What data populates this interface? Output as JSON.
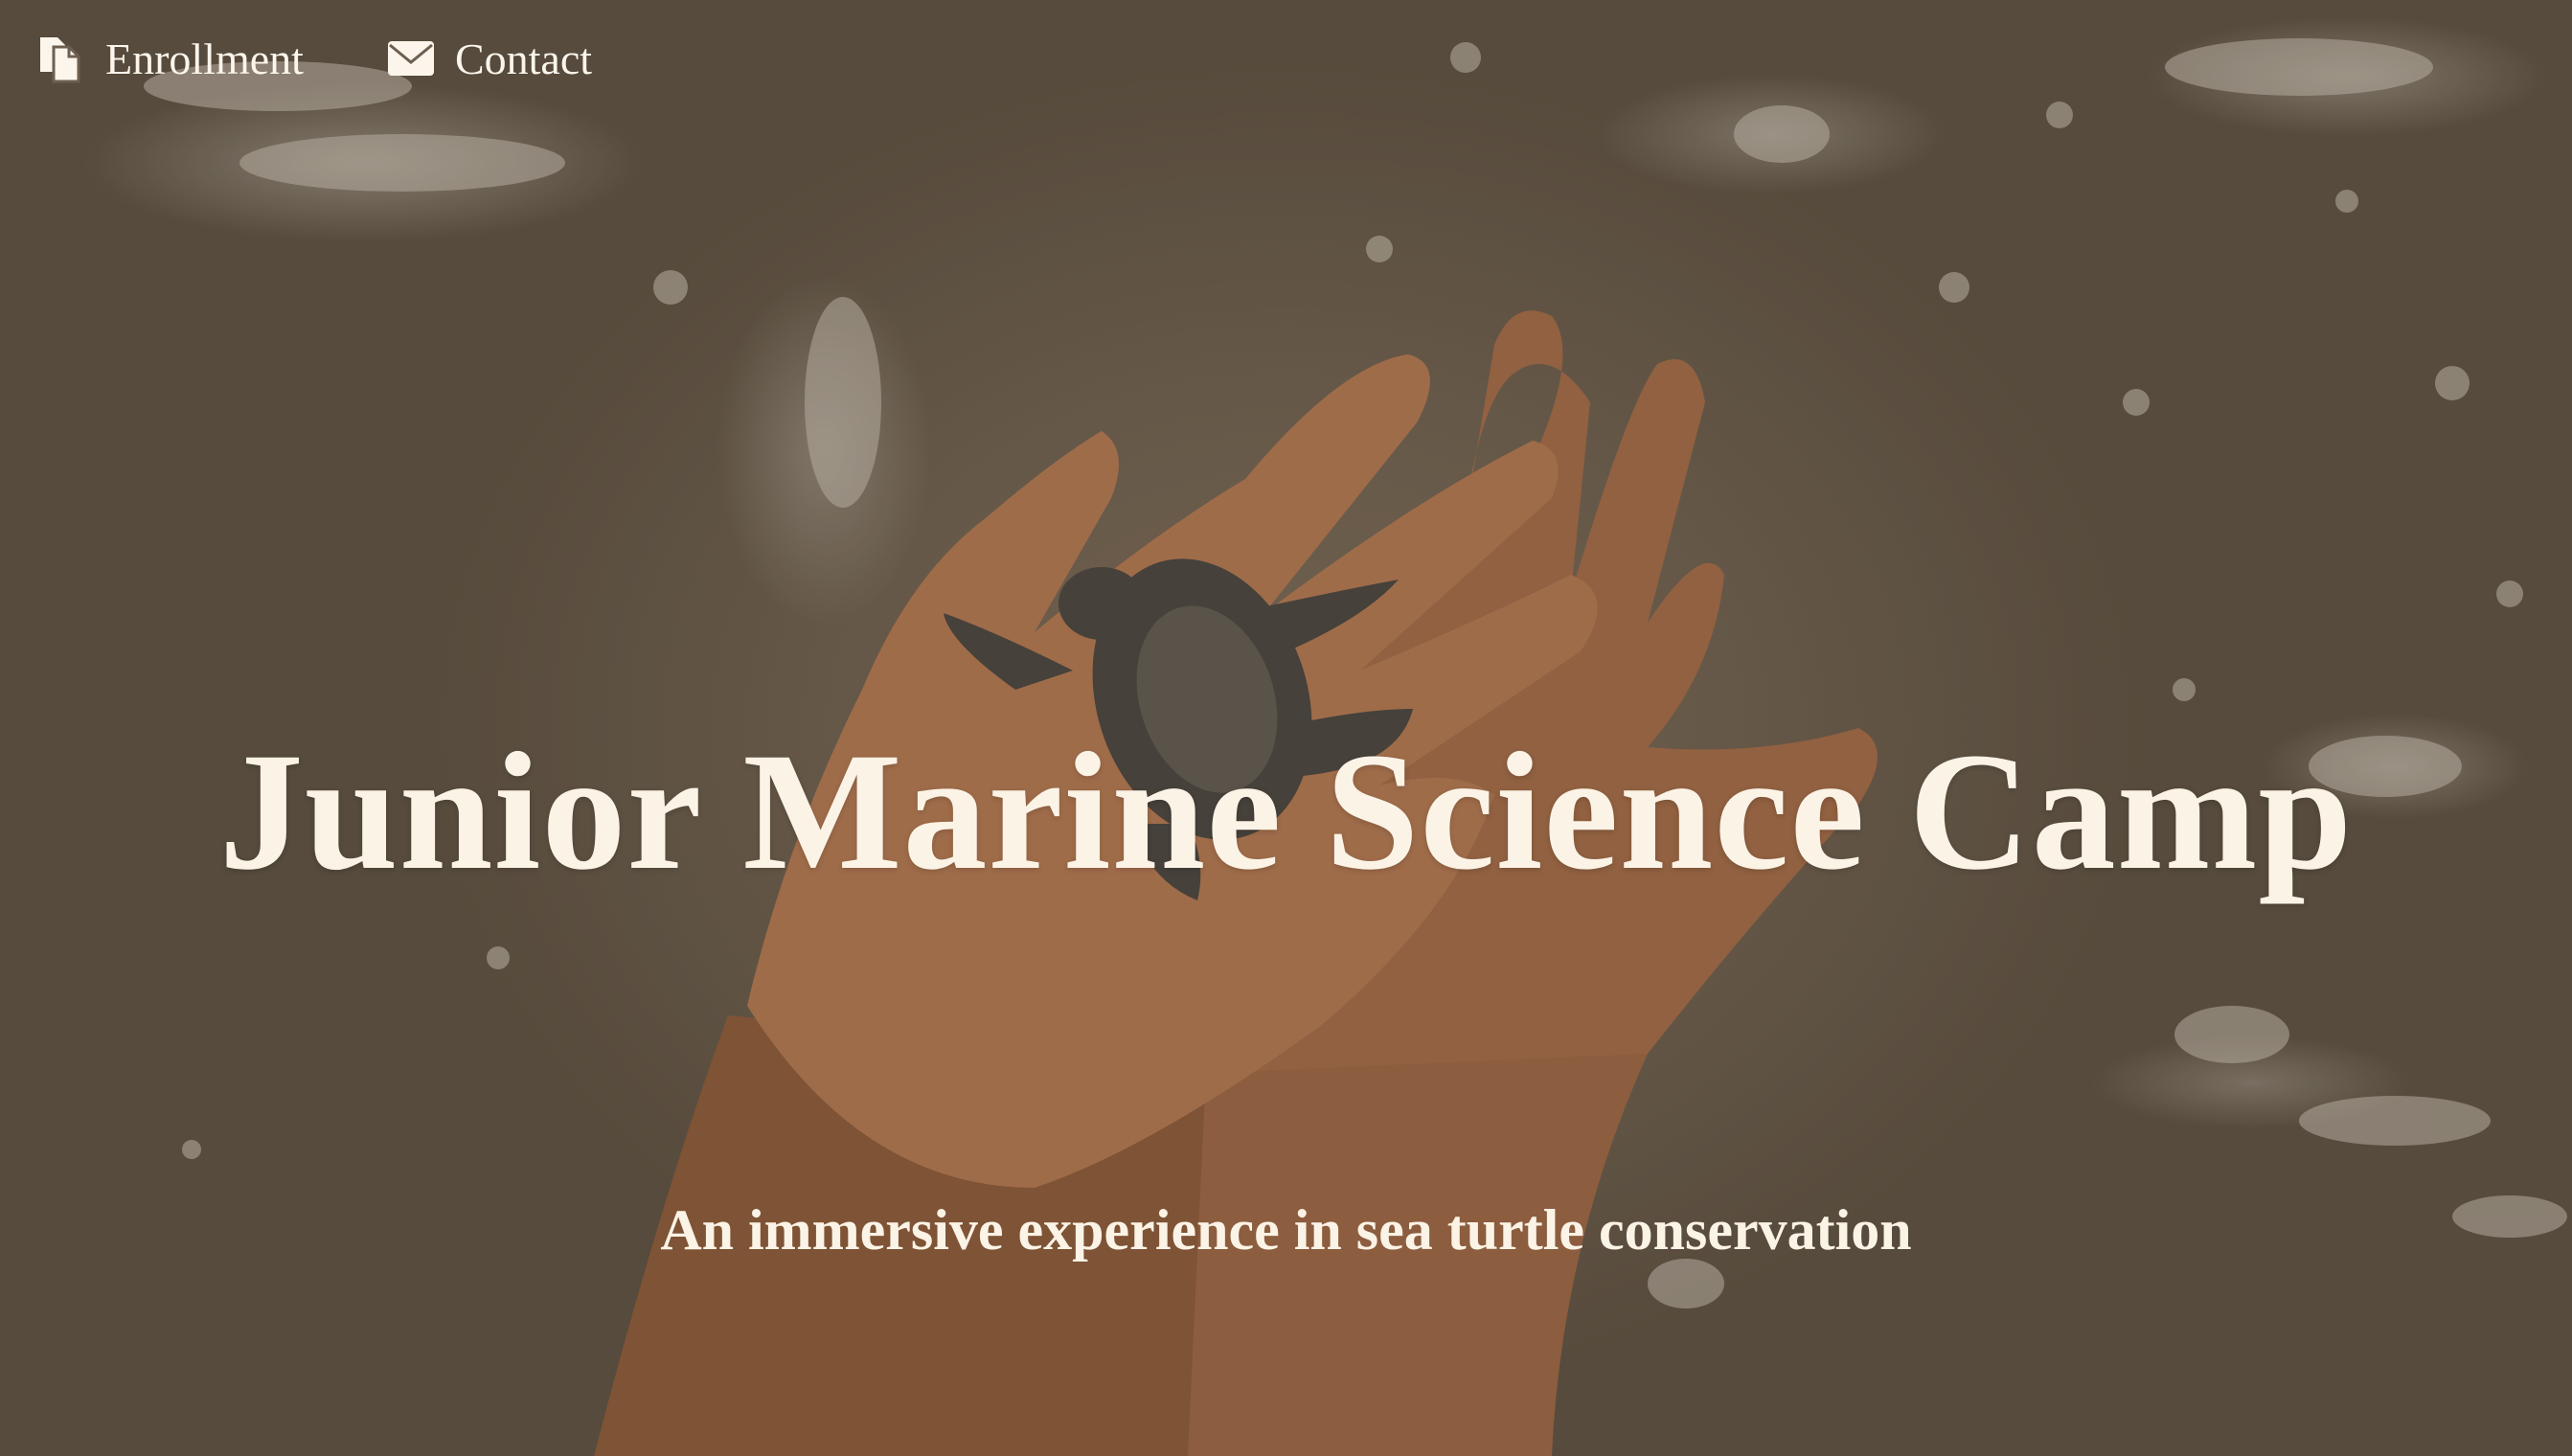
{
  "nav": {
    "items": [
      {
        "label": "Enrollment",
        "icon": "documents-icon"
      },
      {
        "label": "Contact",
        "icon": "envelope-icon"
      }
    ]
  },
  "hero": {
    "title": "Junior Marine Science Camp",
    "subtitle": "An immersive experience in sea turtle conservation",
    "image_subject": "hatchling-sea-turtle-in-cupped-hands",
    "text_color": "#fbf3e6",
    "background_color": "#6d5f4f"
  }
}
